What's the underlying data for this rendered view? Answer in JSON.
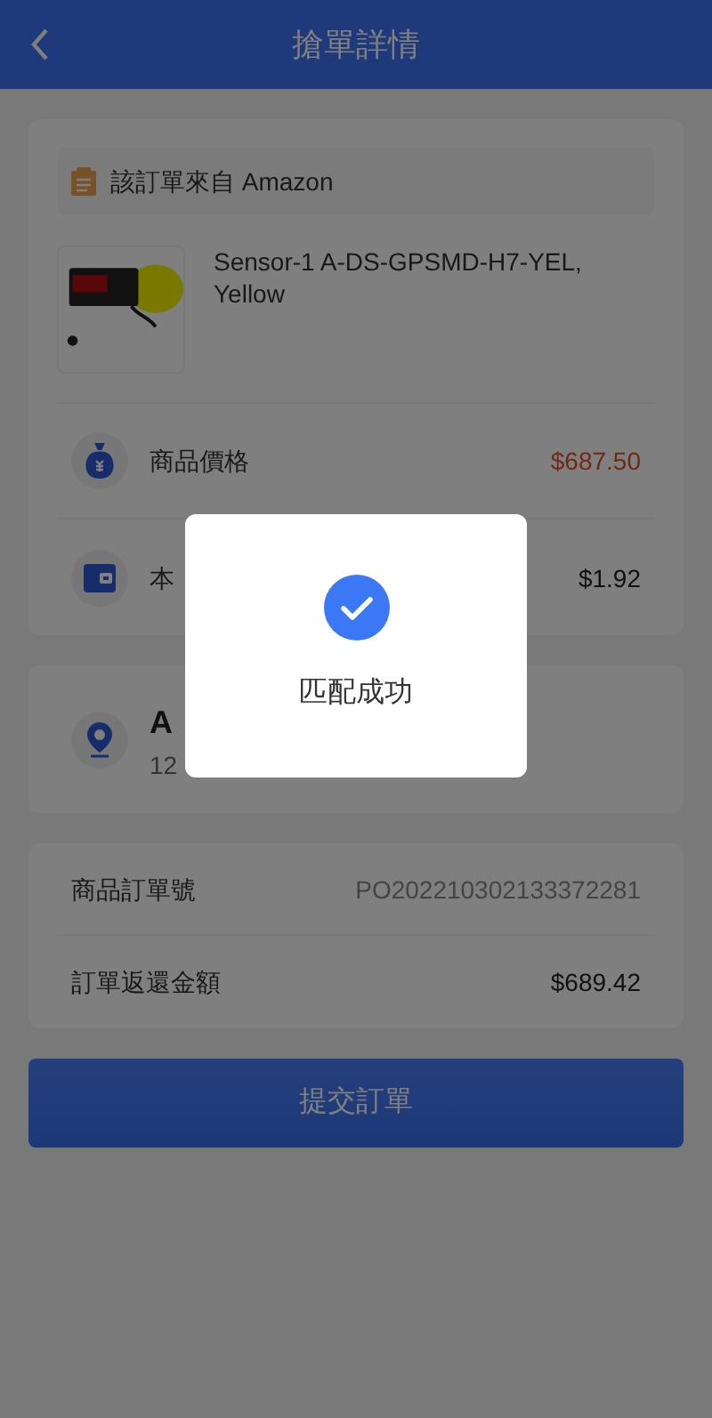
{
  "header": {
    "title": "搶單詳情"
  },
  "source": {
    "text": "該訂單來自 Amazon"
  },
  "product": {
    "name": "Sensor-1 A-DS-GPSMD-H7-YEL, Yellow"
  },
  "amounts": [
    {
      "kind": "price",
      "label": "商品價格",
      "value": "$687.50"
    },
    {
      "kind": "wallet",
      "label": "本",
      "value": "$1.92"
    }
  ],
  "address": {
    "name": "A",
    "line": "12"
  },
  "order": [
    {
      "label": "商品訂單號",
      "value": "PO202210302133372281",
      "muted": true
    },
    {
      "label": "訂單返還金額",
      "value": "$689.42",
      "muted": false
    }
  ],
  "submit": "提交訂單",
  "dialog": {
    "message": "匹配成功"
  }
}
